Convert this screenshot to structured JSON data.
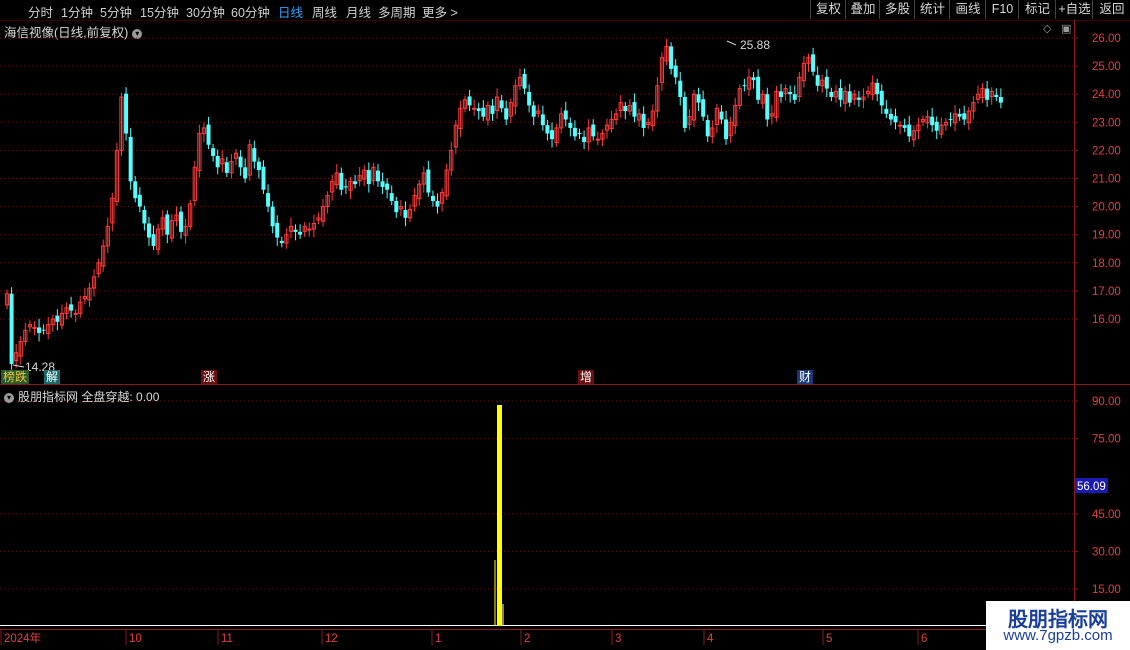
{
  "toolbar": {
    "timeframes": [
      "分时",
      "1分钟",
      "5分钟",
      "15分钟",
      "30分钟",
      "60分钟",
      "日线",
      "周线",
      "月线",
      "多周期",
      "更多 >"
    ],
    "active_timeframe": "日线",
    "buttons": [
      "复权",
      "叠加",
      "多股",
      "统计",
      "画线",
      "F10",
      "标记",
      "+自选",
      "返回"
    ]
  },
  "main_chart": {
    "title": "海信视像(日线,前复权)",
    "high_label": "25.88",
    "low_label": "14.28",
    "price_axis": [
      "26.00",
      "25.00",
      "24.00",
      "23.00",
      "22.00",
      "21.00",
      "20.00",
      "19.00",
      "18.00",
      "17.00",
      "16.00"
    ],
    "event_tags": [
      {
        "text": "榜跌",
        "color": "#f0c040",
        "bg": "#2a5a2a"
      },
      {
        "text": "解",
        "color": "#ffffff",
        "bg": "#1a6a6a"
      },
      {
        "text": "涨",
        "color": "#ffffff",
        "bg": "#6a1010"
      },
      {
        "text": "增",
        "color": "#ffffff",
        "bg": "#6a1010"
      },
      {
        "text": "财",
        "color": "#ffffff",
        "bg": "#1a3a7a"
      }
    ]
  },
  "indicator": {
    "title": "股朋指标网",
    "line_label": "全盘穿越: 0.00",
    "axis": [
      "90.00",
      "75.00",
      "56.09",
      "45.00",
      "30.00",
      "15.00"
    ],
    "highlight_value": "56.09"
  },
  "x_axis": [
    "2024年",
    "10",
    "11",
    "12",
    "1",
    "2",
    "3",
    "4",
    "5",
    "6"
  ],
  "watermark": {
    "title": "股朋指标网",
    "url": "www.7gpzb.com"
  },
  "colors": {
    "up": "#ff3c3c",
    "down": "#54ffff",
    "grid": "#6a1010",
    "indicator_bar": "#ffff00",
    "axis_text": "#e04040"
  },
  "chart_data": {
    "type": "candlestick",
    "price_range": [
      14.0,
      26.4
    ],
    "closes": [
      16.9,
      14.4,
      14.8,
      15.2,
      15.6,
      15.8,
      15.7,
      15.5,
      15.6,
      15.8,
      16.0,
      15.9,
      16.2,
      16.4,
      16.3,
      16.2,
      16.6,
      16.8,
      17.1,
      17.5,
      18.0,
      18.6,
      19.3,
      20.3,
      22.0,
      23.9,
      22.6,
      20.9,
      20.3,
      20.0,
      19.4,
      18.9,
      18.6,
      19.2,
      19.6,
      19.0,
      19.5,
      19.7,
      19.1,
      19.3,
      20.1,
      21.4,
      22.6,
      22.8,
      22.2,
      21.8,
      21.4,
      21.7,
      21.2,
      21.6,
      21.9,
      21.4,
      21.0,
      22.2,
      21.6,
      21.3,
      20.6,
      20.0,
      19.3,
      18.9,
      18.7,
      19.0,
      19.3,
      19.1,
      19.0,
      19.3,
      19.2,
      19.4,
      19.6,
      20.0,
      20.4,
      20.9,
      21.2,
      20.6,
      20.7,
      20.9,
      20.8,
      21.1,
      21.3,
      20.8,
      21.4,
      20.9,
      20.7,
      20.6,
      20.2,
      19.8,
      20.0,
      19.6,
      19.9,
      20.4,
      20.8,
      21.2,
      20.5,
      20.2,
      20.0,
      20.5,
      21.3,
      22.0,
      22.9,
      23.5,
      23.8,
      23.6,
      23.5,
      23.4,
      23.2,
      23.6,
      23.3,
      23.9,
      23.5,
      23.1,
      23.7,
      24.3,
      24.6,
      24.2,
      23.6,
      23.2,
      23.4,
      22.9,
      22.6,
      22.4,
      22.8,
      23.3,
      23.1,
      22.8,
      22.5,
      22.6,
      22.3,
      22.8,
      22.5,
      22.4,
      22.6,
      22.9,
      23.1,
      23.3,
      23.7,
      23.4,
      23.6,
      23.2,
      23.3,
      22.8,
      23.0,
      23.4,
      24.3,
      25.3,
      25.7,
      24.9,
      24.6,
      23.9,
      22.8,
      23.2,
      24.0,
      23.7,
      23.2,
      22.5,
      22.8,
      23.5,
      23.1,
      22.4,
      23.0,
      23.6,
      24.2,
      24.3,
      24.6,
      24.5,
      23.8,
      24.0,
      23.1,
      23.3,
      24.1,
      23.9,
      24.2,
      24.0,
      23.8,
      24.6,
      25.1,
      25.3,
      24.8,
      24.3,
      24.5,
      24.2,
      23.9,
      24.1,
      23.8,
      24.1,
      23.7,
      24.0,
      23.8,
      23.9,
      24.1,
      24.4,
      24.0,
      23.6,
      23.3,
      23.1,
      23.0,
      22.9,
      22.8,
      22.5,
      22.7,
      22.9,
      23.1,
      23.2,
      22.9,
      22.7,
      22.9,
      23.0,
      23.1,
      23.3,
      23.2,
      23.1,
      23.4,
      23.7,
      24.0,
      24.2,
      23.8,
      24.1,
      23.9,
      23.7
    ]
  }
}
